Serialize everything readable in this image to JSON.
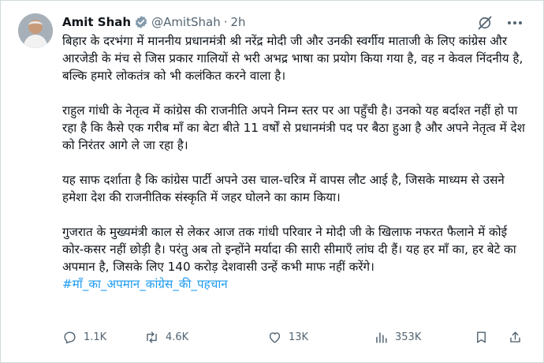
{
  "author": {
    "name": "Amit Shah",
    "handle": "@AmitShah",
    "separator": "·",
    "time": "2h"
  },
  "body": {
    "paragraphs": [
      "बिहार के दरभंगा में माननीय प्रधानमंत्री श्री नरेंद्र मोदी जी और उनकी स्वर्गीय माताजी के लिए कांग्रेस और आरजेडी के मंच से जिस प्रकार गालियों से भरी अभद्र भाषा का प्रयोग किया गया है, वह न केवल निंदनीय है, बल्कि हमारे लोकतंत्र को भी कलंकित करने वाला है।",
      "राहुल गांधी के नेतृत्व में कांग्रेस की राजनीति अपने निम्न स्तर पर आ पहुँची है। उनको यह बर्दाश्त नहीं हो पा रहा है कि कैसे एक गरीब माँ का बेटा बीते 11 वर्षों से प्रधानमंत्री पद पर बैठा हुआ है और अपने नेतृत्व में देश को निरंतर आगे ले जा रहा है।",
      "यह साफ दर्शाता है कि कांग्रेस पार्टी अपने उस चाल-चरित्र में वापस लौट आई है, जिसके माध्यम से उसने हमेशा देश की राजनीतिक संस्कृति में जहर घोलने का काम किया।",
      "गुजरात के मुख्यमंत्री काल से लेकर आज तक गांधी परिवार ने मोदी जी के खिलाफ नफरत फैलाने में कोई कोर-कसर नहीं छोड़ी है। परंतु अब तो इन्होंने मर्यादा की सारी सीमाएँ लांघ दी हैं। यह हर माँ का, हर बेटे का अपमान है, जिसके लिए 140 करोड़ देशवासी उन्हें कभी माफ नहीं करेंगे।"
    ],
    "hashtag": "#माँ_का_अपमान_कांग्रेस_की_पहचान"
  },
  "actions": {
    "replies": "1.1K",
    "retweets": "4.6K",
    "likes": "13K",
    "views": "353K"
  },
  "colors": {
    "accent": "#1d9bf0",
    "muted": "#536471",
    "text": "#0f1419",
    "border": "#cfd9de"
  },
  "icons": [
    "verified-badge-icon",
    "grok-icon",
    "more-icon",
    "reply-icon",
    "retweet-icon",
    "like-icon",
    "views-icon",
    "bookmark-icon",
    "share-icon"
  ]
}
